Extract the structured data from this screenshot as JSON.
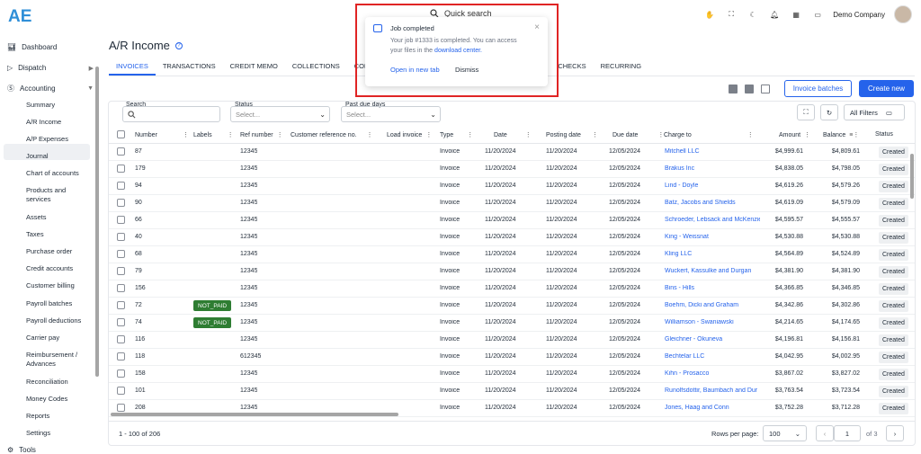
{
  "header": {
    "logo_text": "AE",
    "search_placeholder": "Quick search",
    "company": "Demo Company"
  },
  "sidebar": {
    "items": [
      {
        "label": "Dashboard",
        "icon": "bar-chart-icon"
      },
      {
        "label": "Dispatch",
        "icon": "send-icon"
      },
      {
        "label": "Accounting",
        "icon": "dollar-icon"
      }
    ],
    "sub_items": [
      "Summary",
      "A/R Income",
      "A/P Expenses",
      "Journal",
      "Chart of accounts",
      "Products and services",
      "Assets",
      "Taxes",
      "Purchase order",
      "Credit accounts",
      "Customer billing",
      "Payroll batches",
      "Payroll deductions",
      "Carrier pay",
      "Reimbursement / Advances",
      "Reconciliation",
      "Money Codes",
      "Reports",
      "Settings"
    ],
    "bottom_item": "Tools"
  },
  "page": {
    "title": "A/R Income",
    "tabs": [
      "INVOICES",
      "TRANSACTIONS",
      "CREDIT MEMO",
      "COLLECTIONS",
      "COLLECT",
      "CHECKS",
      "RECURRING"
    ],
    "invoice_batches_label": "Invoice batches",
    "create_new_label": "Create new"
  },
  "filters": {
    "search_label": "Search",
    "status_label": "Status",
    "status_placeholder": "Select...",
    "past_due_label": "Past due days",
    "past_due_placeholder": "Select...",
    "all_filters_label": "All Filters"
  },
  "table": {
    "columns": [
      "Number",
      "Labels",
      "Ref number",
      "Customer reference no.",
      "Load invoice",
      "Type",
      "Date",
      "Posting date",
      "Due date",
      "Charge to",
      "Amount",
      "Balance",
      "Status"
    ],
    "rows": [
      {
        "number": "87",
        "label": "",
        "ref": "12345",
        "type": "Invoice",
        "date": "11/20/2024",
        "posting": "11/20/2024",
        "due": "12/05/2024",
        "charge": "Mitchell LLC",
        "amount": "$4,999.61",
        "balance": "$4,809.61",
        "status": "Created"
      },
      {
        "number": "179",
        "label": "",
        "ref": "12345",
        "type": "Invoice",
        "date": "11/20/2024",
        "posting": "11/20/2024",
        "due": "12/05/2024",
        "charge": "Brakus Inc",
        "amount": "$4,838.05",
        "balance": "$4,798.05",
        "status": "Created"
      },
      {
        "number": "94",
        "label": "",
        "ref": "12345",
        "type": "Invoice",
        "date": "11/20/2024",
        "posting": "11/20/2024",
        "due": "12/05/2024",
        "charge": "Lind - Doyle",
        "amount": "$4,619.26",
        "balance": "$4,579.26",
        "status": "Created"
      },
      {
        "number": "90",
        "label": "",
        "ref": "12345",
        "type": "Invoice",
        "date": "11/20/2024",
        "posting": "11/20/2024",
        "due": "12/05/2024",
        "charge": "Batz, Jacobs and Shields",
        "amount": "$4,619.09",
        "balance": "$4,579.09",
        "status": "Created"
      },
      {
        "number": "66",
        "label": "",
        "ref": "12345",
        "type": "Invoice",
        "date": "11/20/2024",
        "posting": "11/20/2024",
        "due": "12/05/2024",
        "charge": "Schroeder, Lebsack and McKenzie",
        "amount": "$4,595.57",
        "balance": "$4,555.57",
        "status": "Created"
      },
      {
        "number": "40",
        "label": "",
        "ref": "12345",
        "type": "Invoice",
        "date": "11/20/2024",
        "posting": "11/20/2024",
        "due": "12/05/2024",
        "charge": "King - Weissnat",
        "amount": "$4,530.88",
        "balance": "$4,530.88",
        "status": "Created"
      },
      {
        "number": "68",
        "label": "",
        "ref": "12345",
        "type": "Invoice",
        "date": "11/20/2024",
        "posting": "11/20/2024",
        "due": "12/05/2024",
        "charge": "Kling LLC",
        "amount": "$4,564.89",
        "balance": "$4,524.89",
        "status": "Created"
      },
      {
        "number": "79",
        "label": "",
        "ref": "12345",
        "type": "Invoice",
        "date": "11/20/2024",
        "posting": "11/20/2024",
        "due": "12/05/2024",
        "charge": "Wuckert, Kassulke and Durgan",
        "amount": "$4,381.90",
        "balance": "$4,381.90",
        "status": "Created"
      },
      {
        "number": "156",
        "label": "",
        "ref": "12345",
        "type": "Invoice",
        "date": "11/20/2024",
        "posting": "11/20/2024",
        "due": "12/05/2024",
        "charge": "Bins - Hills",
        "amount": "$4,366.85",
        "balance": "$4,346.85",
        "status": "Created"
      },
      {
        "number": "72",
        "label": "NOT_PAID",
        "ref": "12345",
        "type": "Invoice",
        "date": "11/20/2024",
        "posting": "11/20/2024",
        "due": "12/05/2024",
        "charge": "Boehm, Dicki and Graham",
        "amount": "$4,342.86",
        "balance": "$4,302.86",
        "status": "Created"
      },
      {
        "number": "74",
        "label": "NOT_PAID",
        "ref": "12345",
        "type": "Invoice",
        "date": "11/20/2024",
        "posting": "11/20/2024",
        "due": "12/05/2024",
        "charge": "Williamson - Swaniawski",
        "amount": "$4,214.65",
        "balance": "$4,174.65",
        "status": "Created"
      },
      {
        "number": "116",
        "label": "",
        "ref": "12345",
        "type": "Invoice",
        "date": "11/20/2024",
        "posting": "11/20/2024",
        "due": "12/05/2024",
        "charge": "Gleichner - Okuneva",
        "amount": "$4,196.81",
        "balance": "$4,156.81",
        "status": "Created"
      },
      {
        "number": "118",
        "label": "",
        "ref": "612345",
        "type": "Invoice",
        "date": "11/20/2024",
        "posting": "11/20/2024",
        "due": "12/05/2024",
        "charge": "Bechtelar LLC",
        "amount": "$4,042.95",
        "balance": "$4,002.95",
        "status": "Created"
      },
      {
        "number": "158",
        "label": "",
        "ref": "12345",
        "type": "Invoice",
        "date": "11/20/2024",
        "posting": "11/20/2024",
        "due": "12/05/2024",
        "charge": "Kihn - Prosacco",
        "amount": "$3,867.02",
        "balance": "$3,827.02",
        "status": "Created"
      },
      {
        "number": "101",
        "label": "",
        "ref": "12345",
        "type": "Invoice",
        "date": "11/20/2024",
        "posting": "11/20/2024",
        "due": "12/05/2024",
        "charge": "Runolfsdottir, Baumbach and Dur",
        "amount": "$3,763.54",
        "balance": "$3,723.54",
        "status": "Created"
      },
      {
        "number": "208",
        "label": "",
        "ref": "12345",
        "type": "Invoice",
        "date": "11/20/2024",
        "posting": "11/20/2024",
        "due": "12/05/2024",
        "charge": "Jones, Haag and Conn",
        "amount": "$3,752.28",
        "balance": "$3,712.28",
        "status": "Created"
      }
    ]
  },
  "footer": {
    "range": "1 - 100 of 206",
    "rows_per_page_label": "Rows per page:",
    "rows_per_page": "100",
    "page": "1",
    "of_pages": "of 3"
  },
  "toast": {
    "title": "Job completed",
    "body": "Your job #1333 is completed. You can access your files in the",
    "link": "download center.",
    "open_label": "Open in new tab",
    "dismiss_label": "Dismiss"
  },
  "colors": {
    "accent": "#2563eb",
    "badge": "#2e7d32",
    "highlight": "#e02424"
  }
}
